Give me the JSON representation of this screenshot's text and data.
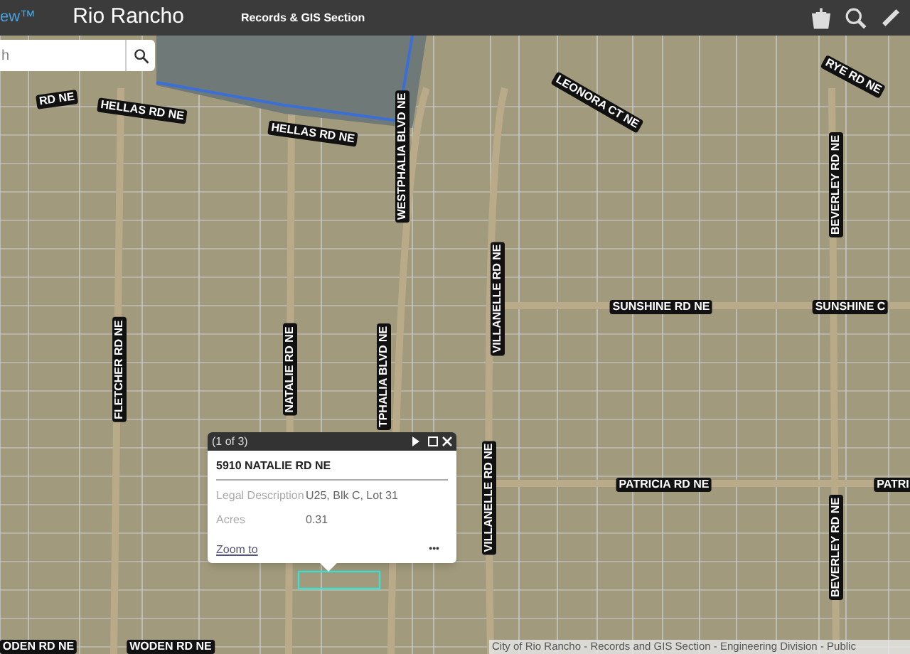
{
  "header": {
    "logo_fragment": "ew™",
    "title": "Rio Rancho",
    "subtitle": "Records & GIS Section"
  },
  "search": {
    "placeholder": "h"
  },
  "street_labels": [
    "RD NE",
    "HELLAS RD NE",
    "HELLAS RD NE",
    "WESTPHALIA BLVD NE",
    "LEONORA CT NE",
    "RYE RD NE",
    "VILLANELLE RD NE",
    "SUNSHINE RD NE",
    "SUNSHINE C",
    "BEVERLEY RD NE",
    "FLETCHER RD NE",
    "NATALIE RD NE",
    "TPHALIA BLVD NE",
    "VILLANELLE RD NE",
    "PATRICIA RD NE",
    "PATRI",
    "BEVERLEY RD NE",
    "ODEN RD NE",
    "WODEN RD NE"
  ],
  "popup": {
    "counter": "(1 of 3)",
    "title": "5910 NATALIE RD NE",
    "fields": [
      {
        "label": "Legal Description",
        "value": "U25, Blk C, Lot 31"
      },
      {
        "label": "Acres",
        "value": "0.31"
      }
    ],
    "link": "Zoom to",
    "more": "•••"
  },
  "attribution": "City of Rio Rancho - Records and GIS Section - Engineering Division - Public"
}
